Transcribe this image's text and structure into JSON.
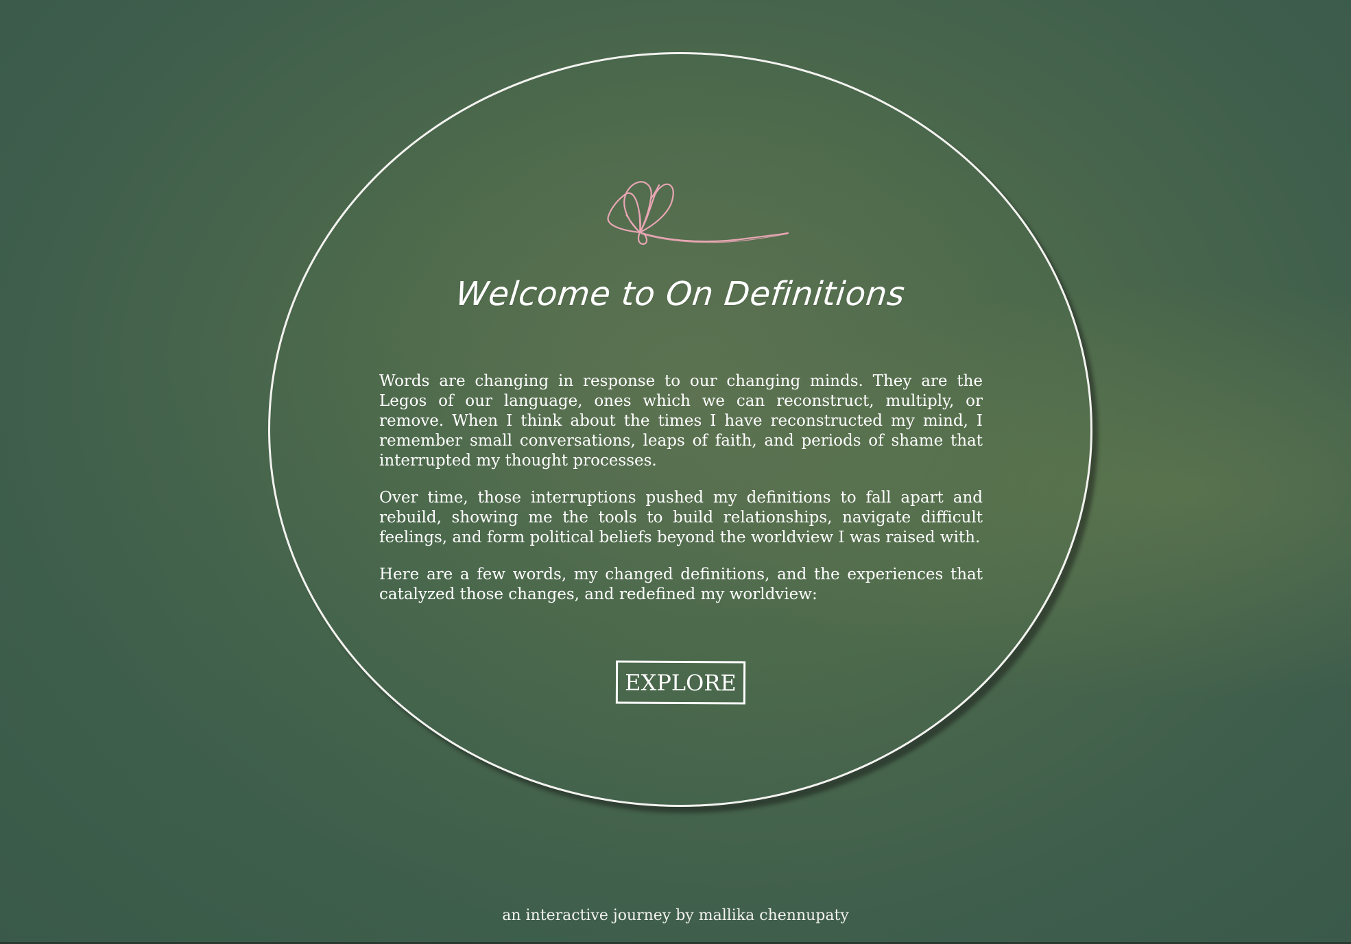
{
  "title": "Welcome to On Definitions",
  "paragraphs": [
    "Words are changing in response to our changing minds. They are the Legos of our language, ones which we can reconstruct, multiply, or remove. When I think about the times I have reconstructed my mind, I remember small conversations, leaps of faith, and periods of shame that interrupted my thought processes.",
    "Over time, those interruptions pushed my definitions to fall apart and rebuild, showing me the tools to build relationships, navigate difficult feelings, and form political beliefs beyond the worldview I was raised with.",
    "Here are a few words, my changed definitions, and the experiences that catalyzed those changes, and redefined my worldview:"
  ],
  "explore_label": "EXPLORE",
  "footer": "an interactive journey by mallika chennupaty",
  "icons": {
    "flower": "flower-icon"
  },
  "colors": {
    "background": "#4d6a4c",
    "text": "#ffffff",
    "flower_stroke": "#e8a6b4",
    "oval_border": "#f3f3f0"
  }
}
